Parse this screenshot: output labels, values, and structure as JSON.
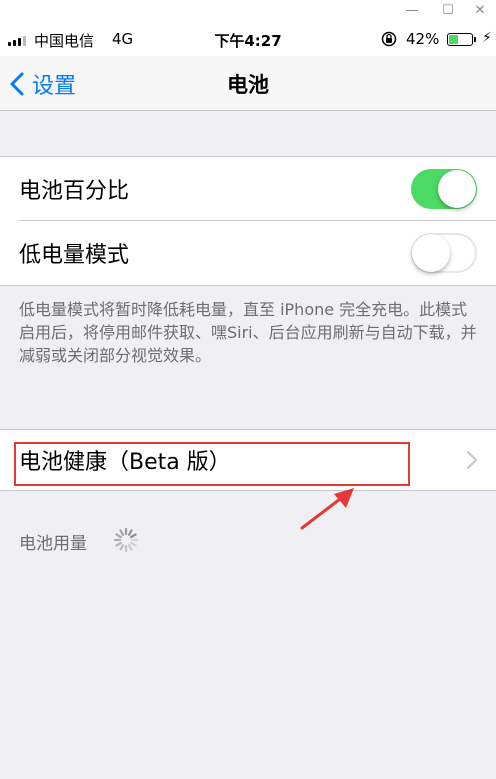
{
  "window": {
    "minimize": "—",
    "maximize": "☐",
    "close": "✕"
  },
  "status_bar": {
    "carrier": "中国电信",
    "network": "4G",
    "time": "下午4:27",
    "battery_percent": "42%",
    "battery_level": 0.42
  },
  "nav": {
    "back_label": "设置",
    "title": "电池"
  },
  "settings": {
    "battery_percentage": {
      "label": "电池百分比",
      "enabled": true
    },
    "low_power_mode": {
      "label": "低电量模式",
      "enabled": false
    },
    "low_power_footnote": "低电量模式将暂时降低耗电量，直至 iPhone 完全充电。此模式启用后，将停用邮件获取、嘿Siri、后台应用刷新与自动下载，并减弱或关闭部分视觉效果。",
    "battery_health": {
      "label": "电池健康（Beta 版）"
    },
    "battery_usage": {
      "label": "电池用量"
    }
  },
  "colors": {
    "accent": "#007aff",
    "toggle_on": "#4cd964",
    "highlight": "#e53935"
  }
}
